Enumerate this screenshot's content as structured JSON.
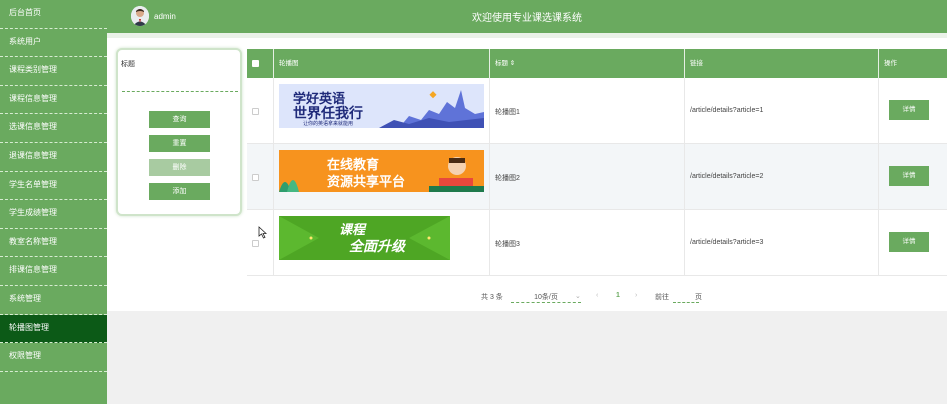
{
  "sidebar": {
    "items": [
      {
        "label": "后台首页"
      },
      {
        "label": "系统用户"
      },
      {
        "label": "课程类别管理"
      },
      {
        "label": "课程信息管理"
      },
      {
        "label": "选课信息管理"
      },
      {
        "label": "退课信息管理"
      },
      {
        "label": "学生名单管理"
      },
      {
        "label": "学生成绩管理"
      },
      {
        "label": "教室名称管理"
      },
      {
        "label": "排课信息管理"
      },
      {
        "label": "系统管理"
      },
      {
        "label": "轮播图管理"
      },
      {
        "label": "权限管理"
      }
    ],
    "active_index": 11
  },
  "header": {
    "username": "admin",
    "site_title": "欢迎使用专业课选课系统"
  },
  "search": {
    "label": "标题",
    "value": "",
    "buttons": {
      "query": "查询",
      "reset": "重置",
      "delete": "删除",
      "add": "添加"
    }
  },
  "table": {
    "headers": {
      "image": "轮播图",
      "title": "标题 ⇕",
      "link": "链接",
      "action": "操作"
    },
    "rows": [
      {
        "title": "轮播图1",
        "link": "/article/details?article=1",
        "action": "详情",
        "banner": {
          "line1": "学好英语",
          "line2": "世界任我行",
          "line3": "让你的英语拿来就能用"
        }
      },
      {
        "title": "轮播图2",
        "link": "/article/details?article=2",
        "action": "详情",
        "banner": {
          "line1": "在线教育",
          "line2": "资源共享平台"
        }
      },
      {
        "title": "轮播图3",
        "link": "/article/details?article=3",
        "action": "详情",
        "banner": {
          "line1": "课程",
          "line2": "全面升级"
        }
      }
    ]
  },
  "pagination": {
    "total": "共 3 条",
    "page_size": "10条/页",
    "prev": "‹",
    "current": "1",
    "next": "›",
    "goto_label": "前往",
    "goto_value": "",
    "page_suffix": "页"
  },
  "colors": {
    "primary": "#6aaa5f",
    "active": "#0c5a17"
  }
}
